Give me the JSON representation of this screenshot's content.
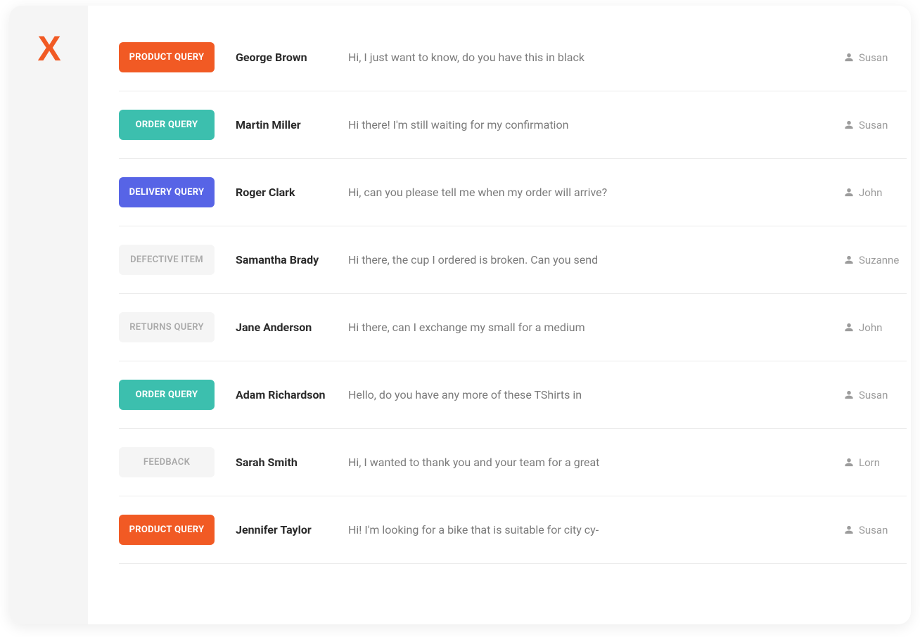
{
  "brand": {
    "logo_text": "X"
  },
  "tag_styles": {
    "PRODUCT QUERY": "product",
    "ORDER QUERY": "order",
    "DELIVERY QUERY": "delivery",
    "DEFECTIVE ITEM": "muted",
    "RETURNS QUERY": "muted",
    "FEEDBACK": "muted"
  },
  "tickets": [
    {
      "tag": "PRODUCT QUERY",
      "customer": "George Brown",
      "preview": "Hi, I just want to know, do you have this in black",
      "assignee": "Susan"
    },
    {
      "tag": "ORDER QUERY",
      "customer": "Martin Miller",
      "preview": "Hi there! I'm still waiting for my confirmation",
      "assignee": "Susan"
    },
    {
      "tag": "DELIVERY QUERY",
      "customer": "Roger Clark",
      "preview": "Hi, can you please tell me when my order will arrive?",
      "assignee": "John"
    },
    {
      "tag": "DEFECTIVE ITEM",
      "customer": "Samantha Brady",
      "preview": "Hi there, the cup I ordered is broken. Can you send",
      "assignee": "Suzanne"
    },
    {
      "tag": "RETURNS QUERY",
      "customer": "Jane Anderson",
      "preview": "Hi there, can I exchange my small for a medium",
      "assignee": "John"
    },
    {
      "tag": "ORDER QUERY",
      "customer": "Adam Richardson",
      "preview": "Hello, do you have any more of these TShirts in",
      "assignee": "Susan"
    },
    {
      "tag": "FEEDBACK",
      "customer": "Sarah Smith",
      "preview": "Hi, I wanted to thank you and your team for a great",
      "assignee": "Lorn"
    },
    {
      "tag": "PRODUCT QUERY",
      "customer": "Jennifer Taylor",
      "preview": "Hi! I'm looking for a bike that is suitable for city cy-",
      "assignee": "Susan"
    }
  ]
}
